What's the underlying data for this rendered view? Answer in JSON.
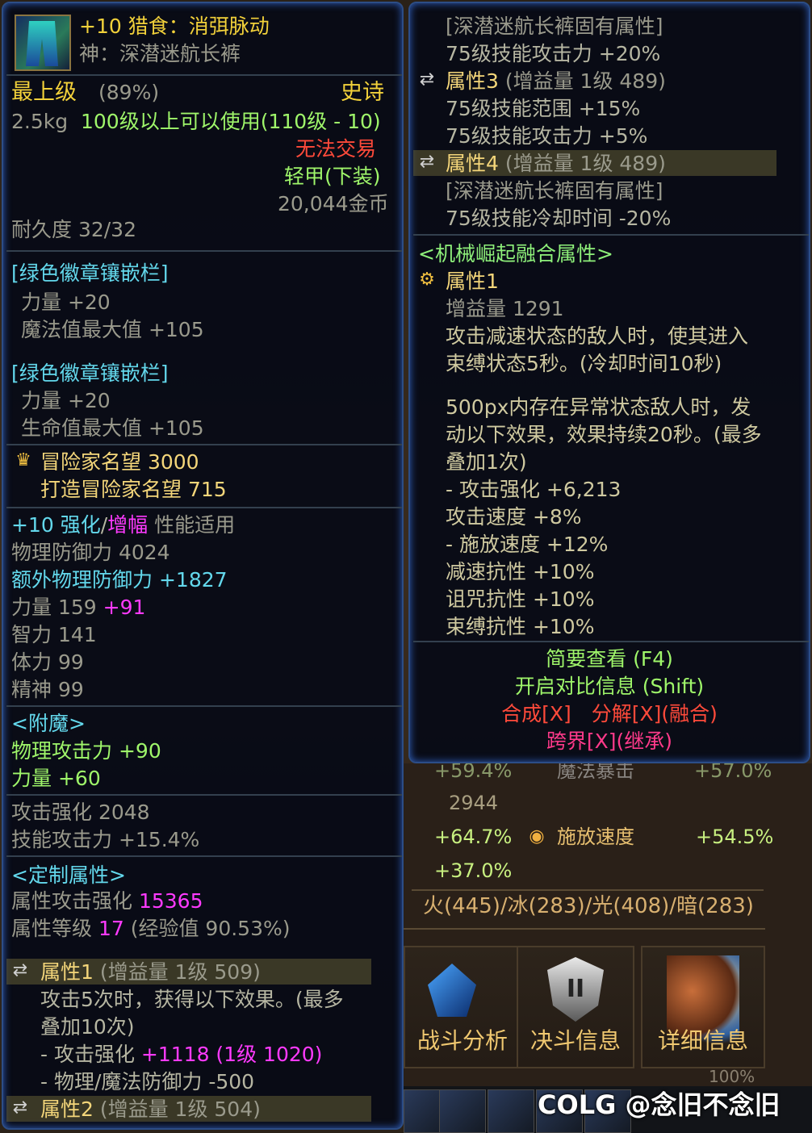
{
  "item": {
    "name_line": "+10 猎食：消弭脉动",
    "type_line": "神：深潜迷航长裤",
    "grade": "最上级",
    "grade_pct": "(89%)",
    "rarity": "史诗",
    "weight": "2.5kg",
    "level_req": "100级以上可以使用(110级 - 10)",
    "trade": "无法交易",
    "slot_type": "轻甲(下装)",
    "price": "20,044金币",
    "durability": "耐久度 32/32"
  },
  "emblems": [
    {
      "title": "[绿色徽章镶嵌栏]",
      "line1": "力量 +20",
      "line2": "魔法值最大值 +105"
    },
    {
      "title": "[绿色徽章镶嵌栏]",
      "line1": "力量 +20",
      "line2": "生命值最大值 +105"
    }
  ],
  "fame": {
    "label": "冒险家名望 3000",
    "forge": "打造冒险家名望 715"
  },
  "enhance": {
    "prefix": "+10 强化",
    "slash": "/",
    "amp": "增幅",
    "suffix": " 性能适用",
    "phys_def": "物理防御力 4024",
    "extra_def_label": "额外物理防御力",
    "extra_def_value": " +1827",
    "str_label": "力量 159",
    "str_bonus": " +91",
    "int": "智力 141",
    "vit": "体力 99",
    "spr": "精神 99"
  },
  "enchant": {
    "title": "<附魔>",
    "line1_label": "物理攻击力",
    "line1_value": " +90",
    "line2_label": "力量",
    "line2_value": " +60"
  },
  "atk": {
    "line1": "攻击强化 2048",
    "line2": "技能攻击力 +15.4%"
  },
  "custom": {
    "title": "<定制属性>",
    "line1_label": "属性攻击强化",
    "line1_value": " 15365",
    "line2_label": "属性等级",
    "line2_value": " 17",
    "line2_extra": " (经验值 90.53%)"
  },
  "attr1": {
    "head": "属性1",
    "head_extra": " (增益量 1级 509)",
    "line1": "攻击5次时，获得以下效果。(最多",
    "line2": "叠加10次)",
    "line3_label": "- 攻击强化",
    "line3_value": " +1118 (1级 1020)",
    "line4": "- 物理/魔法防御力 -500"
  },
  "attr2": {
    "head": "属性2",
    "head_extra": " (增益量 1级 504)"
  },
  "right": {
    "fixed1": "[深潜迷航长裤固有属性]",
    "fixed1_line": "75级技能攻击力 +20%",
    "attr3_head": "属性3",
    "attr3_extra": " (增益量 1级 489)",
    "attr3_l1": "75级技能范围 +15%",
    "attr3_l2": "75级技能攻击力 +5%",
    "attr4_head": "属性4",
    "attr4_extra": " (增益量 1级 489)",
    "fixed2": "[深潜迷航长裤固有属性]",
    "fixed2_line": "75级技能冷却时间 -20%",
    "fusion_title": "<机械崛起融合属性>",
    "fusion_head": "属性1",
    "fusion_buff": "增益量 1291",
    "fusion_l1": "攻击减速状态的敌人时，使其进入",
    "fusion_l2": "束缚状态5秒。(冷却时间10秒)",
    "fusion_l3": "500px内存在异常状态敌人时，发",
    "fusion_l4": "动以下效果，效果持续20秒。(最多",
    "fusion_l5": "叠加1次)",
    "fusion_l6": "- 攻击强化 +6,213",
    "fusion_l7": "攻击速度 +8%",
    "fusion_l8": "- 施放速度 +12%",
    "fusion_l9": "减速抗性 +10%",
    "fusion_l10": "诅咒抗性 +10%",
    "fusion_l11": "束缚抗性 +10%",
    "hint1": "简要查看 (F4)",
    "hint2": "开启对比信息 (Shift)",
    "hint3a": "合成[X]",
    "hint3b": "分解[X](融合)",
    "hint4": "跨界[X](继承)"
  },
  "bottom": {
    "stat_top": "+59.4%",
    "stat_top_label": "魔法暴击",
    "stat_top_right": "+57.0%",
    "val_2944": "2944",
    "val_647": "+64.7%",
    "cast_label": "施放速度",
    "cast_value": "+54.5%",
    "val_370": "+37.0%",
    "elements": "火(445)/冰(283)/光(408)/暗(283)",
    "btn1": "战斗分析",
    "btn2": "决斗信息",
    "btn3": "详细信息",
    "shield_text": "II",
    "watermark": "COLG @念旧不念旧",
    "pct_100": "100%"
  },
  "icons": [
    "item-icon",
    "shuffle-icon",
    "crown-icon",
    "fusion-gear-icon"
  ]
}
